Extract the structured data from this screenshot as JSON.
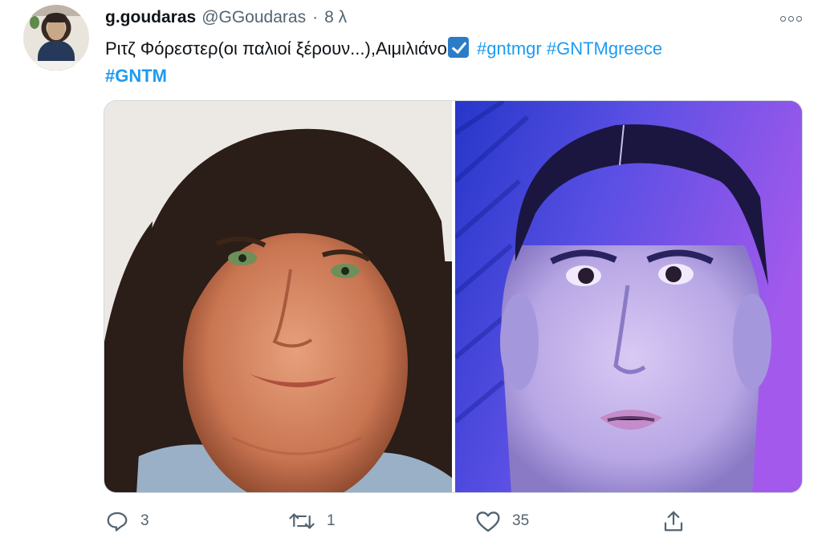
{
  "tweet": {
    "display_name": "g.goudaras",
    "handle": "@GGoudaras",
    "separator": "·",
    "time": "8 λ",
    "text_plain": "Ριτζ Φόρεστερ(οι παλιοί ξέρουν...),Αιμιλιάνο",
    "check_icon": "check-box-emoji",
    "hashtags": [
      "#gntmgr",
      "#GNTMgreece",
      "#GNTM"
    ],
    "colors": {
      "hashtag": "#1d9bf0",
      "secondary_text": "#536471",
      "primary_text": "#0f1419"
    }
  },
  "media": {
    "left_image": "photo-long-dark-haired-man",
    "right_image": "photo-tv-still-dark-haired-man"
  },
  "actions": {
    "reply_icon": "reply-icon",
    "reply_count": "3",
    "retweet_icon": "retweet-icon",
    "retweet_count": "1",
    "like_icon": "heart-icon",
    "like_count": "35",
    "share_icon": "share-icon"
  }
}
